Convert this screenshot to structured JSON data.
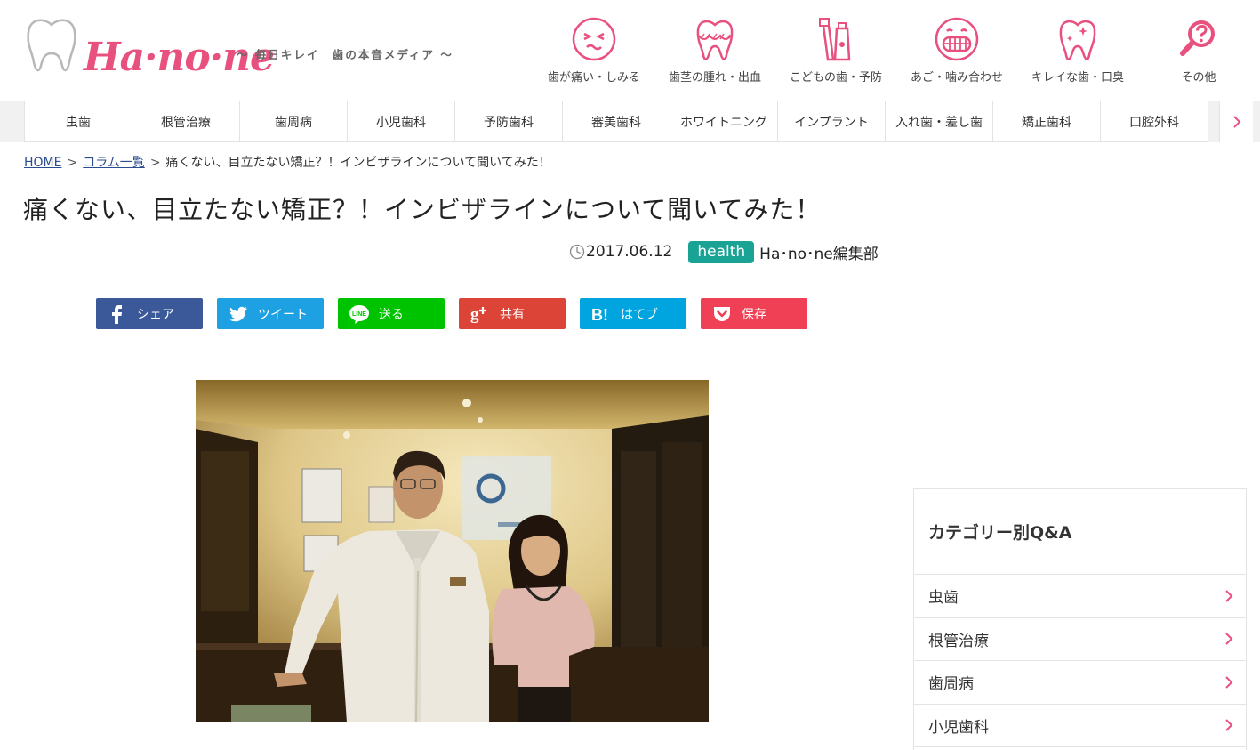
{
  "header": {
    "logo_text": "Ha·no·ne",
    "tagline": "〜 毎日キレイ　歯の本音メディア 〜",
    "brand_color": "#e8507e",
    "categories": [
      {
        "label": "歯が痛い・しみる",
        "icon": "painful-face-icon"
      },
      {
        "label": "歯茎の腫れ・出血",
        "icon": "swollen-gum-tooth-icon"
      },
      {
        "label": "こどもの歯・予防",
        "icon": "toothbrush-paste-icon"
      },
      {
        "label": "あご・噛み合わせ",
        "icon": "grinning-face-icon"
      },
      {
        "label": "キレイな歯・口臭",
        "icon": "sparkling-tooth-icon"
      },
      {
        "label": "その他",
        "icon": "question-search-icon"
      }
    ]
  },
  "nav": {
    "items": [
      "虫歯",
      "根管治療",
      "歯周病",
      "小児歯科",
      "予防歯科",
      "審美歯科",
      "ホワイトニング",
      "インプラント",
      "入れ歯・差し歯",
      "矯正歯科",
      "口腔外科"
    ],
    "next_icon": "chevron-right-icon"
  },
  "breadcrumb": {
    "home": "HOME",
    "sep": ">",
    "column_list": "コラム一覧",
    "current": "痛くない、目立たない矯正？！インビザラインについて聞いてみた！"
  },
  "article": {
    "title": "痛くない、目立たない矯正？！インビザラインについて聞いてみた！",
    "date": "2017.06.12",
    "tag": "health",
    "tag_color": "#19a394",
    "author": "Ha･no･ne編集部"
  },
  "share": [
    {
      "label": "シェア",
      "icon": "facebook-icon",
      "color": "#3b5998"
    },
    {
      "label": "ツイート",
      "icon": "twitter-icon",
      "color": "#1da1e2"
    },
    {
      "label": "送る",
      "icon": "line-icon",
      "color": "#00c300"
    },
    {
      "label": "共有",
      "icon": "google-plus-icon",
      "color": "#db4437"
    },
    {
      "label": "はてブ",
      "icon": "hatena-bookmark-icon",
      "color": "#00a4de"
    },
    {
      "label": "保存",
      "icon": "pocket-icon",
      "color": "#ef4056"
    }
  ],
  "sidebar": {
    "title": "カテゴリー別Q&A",
    "items": [
      "虫歯",
      "根管治療",
      "歯周病",
      "小児歯科"
    ]
  }
}
